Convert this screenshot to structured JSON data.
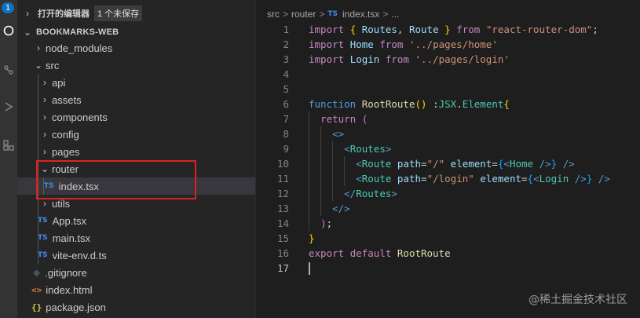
{
  "activity_bar": {
    "badge": "1",
    "icons": [
      "files-icon",
      "search-icon",
      "source-control-icon",
      "run-debug-icon",
      "extensions-icon"
    ]
  },
  "sidebar": {
    "open_editors_label": "打开的编辑器",
    "unsaved_badge": "1 个未保存",
    "workspace_label": "BOOKMARKS-WEB",
    "tree": [
      {
        "label": "node_modules",
        "kind": "folder",
        "expanded": false
      },
      {
        "label": "src",
        "kind": "folder",
        "expanded": true
      },
      {
        "label": "api",
        "kind": "folder",
        "expanded": false
      },
      {
        "label": "assets",
        "kind": "folder",
        "expanded": false
      },
      {
        "label": "components",
        "kind": "folder",
        "expanded": false
      },
      {
        "label": "config",
        "kind": "folder",
        "expanded": false
      },
      {
        "label": "pages",
        "kind": "folder",
        "expanded": false
      },
      {
        "label": "router",
        "kind": "folder",
        "expanded": true
      },
      {
        "label": "index.tsx",
        "kind": "ts",
        "selected": true
      },
      {
        "label": "utils",
        "kind": "folder",
        "expanded": false
      },
      {
        "label": "App.tsx",
        "kind": "ts"
      },
      {
        "label": "main.tsx",
        "kind": "ts"
      },
      {
        "label": "vite-env.d.ts",
        "kind": "ts"
      },
      {
        "label": ".gitignore",
        "kind": "git"
      },
      {
        "label": "index.html",
        "kind": "html"
      },
      {
        "label": "package.json",
        "kind": "json"
      }
    ],
    "ts_icon_text": "TS"
  },
  "editor": {
    "breadcrumb": {
      "parts": [
        "src",
        "router",
        "index.tsx",
        "..."
      ],
      "separator": ">"
    },
    "line_numbers": [
      "1",
      "2",
      "3",
      "4",
      "5",
      "6",
      "7",
      "8",
      "9",
      "10",
      "11",
      "12",
      "13",
      "14",
      "15",
      "16",
      "17"
    ],
    "active_line": "17"
  },
  "watermark": "@稀土掘金技术社区",
  "colors": {
    "keyword": "#569cd6",
    "control_keyword": "#c586c0",
    "function": "#dcdcaa",
    "type": "#4ec9b0",
    "string": "#ce9178",
    "highlight_box": "#e02020"
  }
}
